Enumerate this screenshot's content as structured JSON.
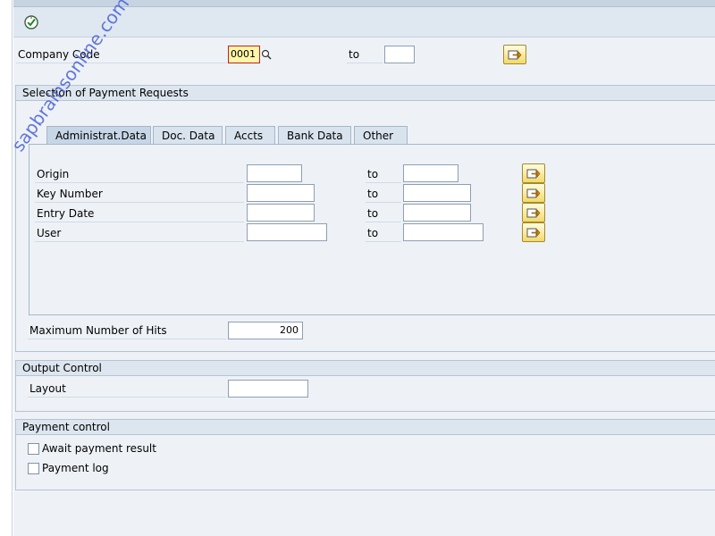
{
  "toolbar": {
    "execute_icon": "execute-clock-icon"
  },
  "company_code": {
    "label": "Company Code",
    "from_value": "0001",
    "to_label": "to",
    "to_value": "",
    "search_icon": "search-help-icon",
    "more_icon": "multiple-selection-arrow-icon"
  },
  "payment_requests": {
    "title": "Selection of Payment Requests",
    "tabs": [
      {
        "label": "Administrat.Data"
      },
      {
        "label": "Doc. Data"
      },
      {
        "label": "Accts"
      },
      {
        "label": "Bank Data"
      },
      {
        "label": "Other"
      }
    ],
    "active_tab": "Administrat.Data",
    "rows": [
      {
        "label": "Origin",
        "from_value": "",
        "to_label": "to",
        "to_value": ""
      },
      {
        "label": "Key Number",
        "from_value": "",
        "to_label": "to",
        "to_value": ""
      },
      {
        "label": "Entry Date",
        "from_value": "",
        "to_label": "to",
        "to_value": ""
      },
      {
        "label": "User",
        "from_value": "",
        "to_label": "to",
        "to_value": ""
      }
    ],
    "max_hits_label": "Maximum Number of Hits",
    "max_hits_value": "200"
  },
  "output_control": {
    "title": "Output Control",
    "layout_label": "Layout",
    "layout_value": ""
  },
  "payment_control": {
    "title": "Payment control",
    "options": [
      {
        "label": "Await payment result",
        "checked": false
      },
      {
        "label": "Payment log",
        "checked": false
      }
    ]
  },
  "watermark": "sapbrainsonline.com",
  "colors": {
    "accent_blue": "#dde6ef",
    "more_button_yellow": "#f3d96a",
    "watermark": "#4a62d8",
    "focus_red": "#c02020"
  }
}
